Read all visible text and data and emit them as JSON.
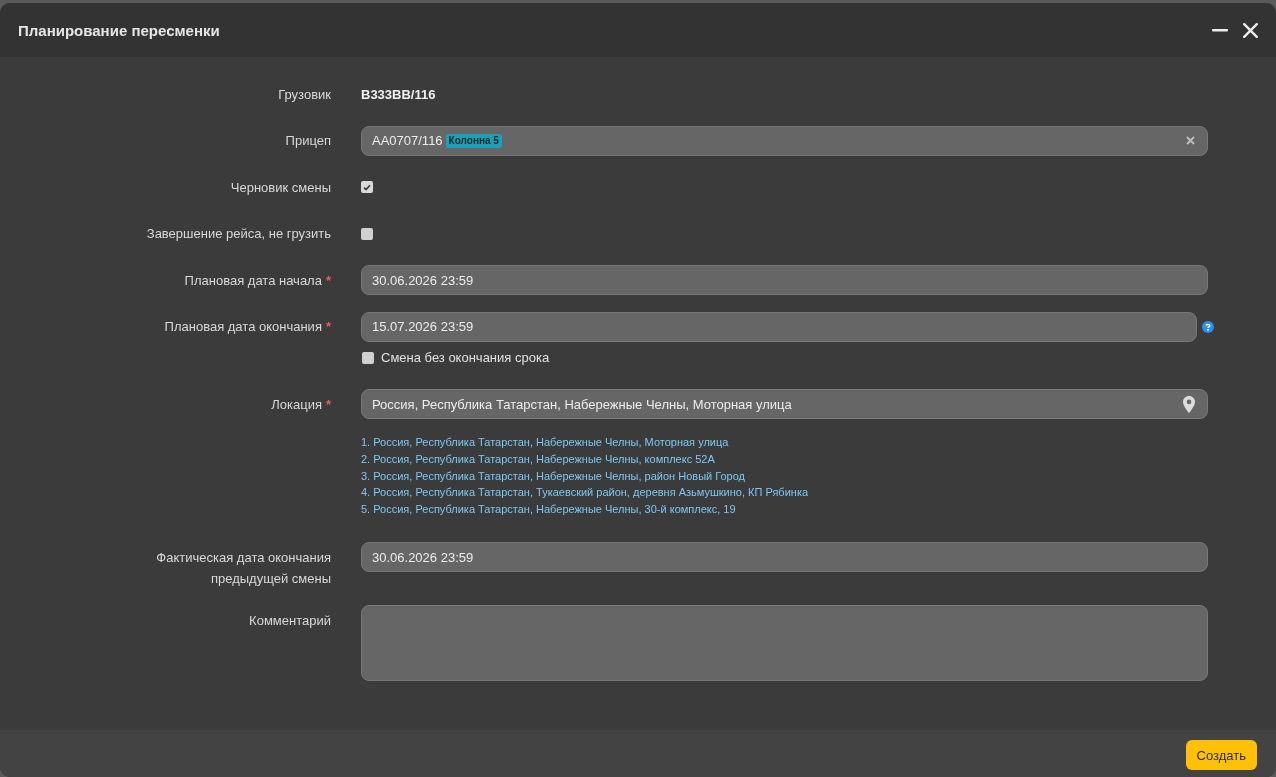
{
  "window": {
    "title": "Планирование пересменки"
  },
  "fields": [
    {
      "kind": "static",
      "label": "Грузовик",
      "value": "В333ВВ/116"
    },
    {
      "kind": "select",
      "label": "Прицеп",
      "value": "АА0707/116",
      "tag": "Колонна 5",
      "clearable": true
    },
    {
      "kind": "checkbox",
      "label": "Черновик смены",
      "checked": true
    },
    {
      "kind": "checkbox",
      "label": "Завершение рейса, не грузить",
      "checked": false
    },
    {
      "kind": "input",
      "label": "Плановая дата начала",
      "required_mark": "*",
      "value": "30.06.2026 23:59"
    },
    {
      "kind": "input",
      "label": "Плановая дата окончания",
      "required_mark": "*",
      "value": "15.07.2026 23:59",
      "help": true,
      "option": {
        "label": "Смена без окончания срока",
        "checked": false
      }
    },
    {
      "kind": "location",
      "label": "Локация",
      "required_mark": "*",
      "value": "Россия, Республика Татарстан, Набережные Челны, Моторная улица",
      "suggestions": [
        "1. Россия, Республика Татарстан, Набережные Челны, Моторная улица",
        "2. Россия, Республика Татарстан, Набережные Челны, комплекс 52А",
        "3. Россия, Республика Татарстан, Набережные Челны, район Новый Город",
        "4. Россия, Республика Татарстан, Тукаевский район, деревня Азьмушкино, КП Рябинка",
        "5. Россия, Республика Татарстан, Набережные Челны, 30-й комплекс, 19"
      ]
    },
    {
      "kind": "input",
      "label": "Фактическая дата окончания предыдущей смены",
      "value": "30.06.2026 23:59"
    },
    {
      "kind": "textarea",
      "label": "Комментарий"
    }
  ],
  "footer": {
    "buttons": [
      {
        "label": "Создать"
      }
    ]
  }
}
